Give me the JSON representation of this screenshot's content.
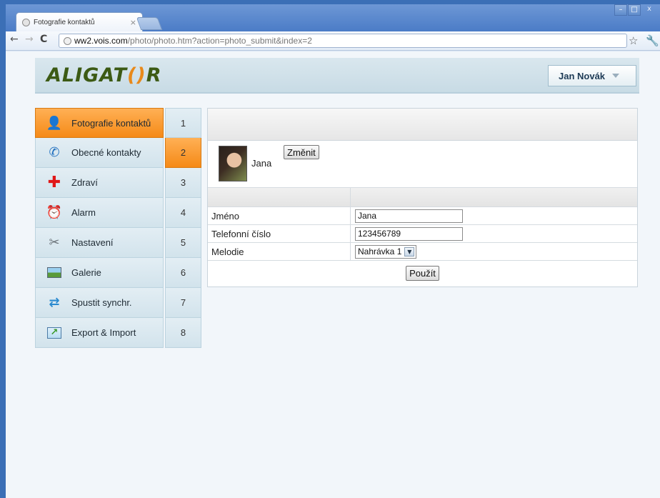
{
  "browser": {
    "tab_title": "Fotografie kontaktů",
    "tab_close": "×",
    "url_host": "ww2.vois.com",
    "url_rest": "/photo/photo.htm?action=photo_submit&index=2",
    "nav_back": "←",
    "nav_forward": "→",
    "nav_reload": "C",
    "star": "☆",
    "wrench": "🔧",
    "win_minimize": "–",
    "win_maximize": "□",
    "win_close": "x"
  },
  "header": {
    "logo_part1": "ALIGAT",
    "logo_o": "()",
    "logo_part2": "R",
    "user_name": "Jan Novák"
  },
  "menu": {
    "items": [
      {
        "label": "Fotografie kontaktů",
        "icon": "person-icon",
        "glyph": "👤",
        "active": true
      },
      {
        "label": "Obecné kontakty",
        "icon": "phone-icon",
        "glyph": "📞",
        "active": false
      },
      {
        "label": "Zdraví",
        "icon": "red-cross-icon",
        "glyph": "✚",
        "active": false
      },
      {
        "label": "Alarm",
        "icon": "alarm-clock-icon",
        "glyph": "⏰",
        "active": false
      },
      {
        "label": "Nastavení",
        "icon": "tools-icon",
        "glyph": "✂",
        "active": false
      },
      {
        "label": "Galerie",
        "icon": "gallery-icon",
        "glyph": "▭",
        "active": false
      },
      {
        "label": "Spustit synchr.",
        "icon": "sync-icon",
        "glyph": "⇄",
        "active": false
      },
      {
        "label": "Export & Import",
        "icon": "export-icon",
        "glyph": "↗",
        "active": false
      }
    ]
  },
  "index": {
    "items": [
      "1",
      "2",
      "3",
      "4",
      "5",
      "6",
      "7",
      "8"
    ],
    "active": "2"
  },
  "contact": {
    "photo_name": "Jana",
    "change_button": "Změnit",
    "fields": {
      "name_label": "Jméno",
      "name_value": "Jana",
      "phone_label": "Telefonní číslo",
      "phone_value": "123456789",
      "melody_label": "Melodie",
      "melody_value": "Nahrávka 1"
    },
    "apply_button": "Použít"
  },
  "colors": {
    "accent_orange": "#f58a17",
    "logo_green": "#3c5a14"
  }
}
